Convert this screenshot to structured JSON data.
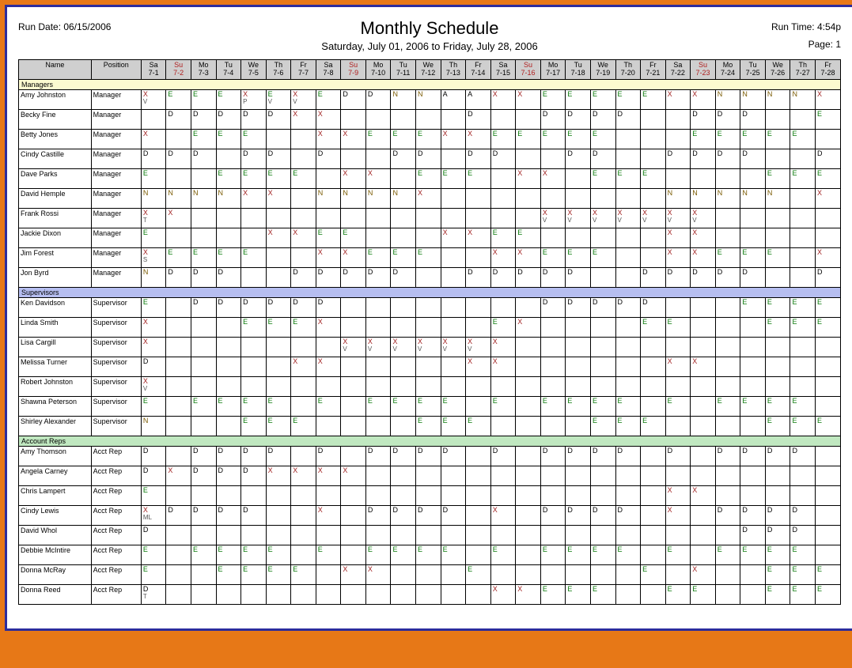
{
  "header": {
    "run_date": "Run Date: 06/15/2006",
    "run_time": "Run Time: 4:54p",
    "title": "Monthly Schedule",
    "range": "Saturday, July 01, 2006 to Friday, July 28, 2006",
    "page": "Page: 1",
    "name_col": "Name",
    "pos_col": "Position"
  },
  "days": [
    {
      "dow": "Sa",
      "md": "7-1"
    },
    {
      "dow": "Su",
      "md": "7-2",
      "sun": true
    },
    {
      "dow": "Mo",
      "md": "7-3"
    },
    {
      "dow": "Tu",
      "md": "7-4"
    },
    {
      "dow": "We",
      "md": "7-5"
    },
    {
      "dow": "Th",
      "md": "7-6"
    },
    {
      "dow": "Fr",
      "md": "7-7"
    },
    {
      "dow": "Sa",
      "md": "7-8"
    },
    {
      "dow": "Su",
      "md": "7-9",
      "sun": true
    },
    {
      "dow": "Mo",
      "md": "7-10"
    },
    {
      "dow": "Tu",
      "md": "7-11"
    },
    {
      "dow": "We",
      "md": "7-12"
    },
    {
      "dow": "Th",
      "md": "7-13"
    },
    {
      "dow": "Fr",
      "md": "7-14"
    },
    {
      "dow": "Sa",
      "md": "7-15"
    },
    {
      "dow": "Su",
      "md": "7-16",
      "sun": true
    },
    {
      "dow": "Mo",
      "md": "7-17"
    },
    {
      "dow": "Tu",
      "md": "7-18"
    },
    {
      "dow": "We",
      "md": "7-19"
    },
    {
      "dow": "Th",
      "md": "7-20"
    },
    {
      "dow": "Fr",
      "md": "7-21"
    },
    {
      "dow": "Sa",
      "md": "7-22"
    },
    {
      "dow": "Su",
      "md": "7-23",
      "sun": true
    },
    {
      "dow": "Mo",
      "md": "7-24"
    },
    {
      "dow": "Tu",
      "md": "7-25"
    },
    {
      "dow": "We",
      "md": "7-26"
    },
    {
      "dow": "Th",
      "md": "7-27"
    },
    {
      "dow": "Fr",
      "md": "7-28"
    }
  ],
  "sections": [
    {
      "label": "Managers",
      "cls": "managers",
      "rows": [
        {
          "name": "Amy Johnston",
          "pos": "Manager",
          "cells": [
            "X/V",
            "E",
            "E",
            "E",
            "X/P",
            "E/V",
            "X/V",
            "E",
            "D",
            "D",
            "N",
            "N",
            "A",
            "A",
            "X",
            "X",
            "E",
            "E",
            "E",
            "E",
            "E",
            "X",
            "X",
            "N",
            "N",
            "N",
            "N",
            "X"
          ]
        },
        {
          "name": "Becky Fine",
          "pos": "Manager",
          "cells": [
            "",
            "D",
            "D",
            "D",
            "D",
            "D",
            "X",
            "X",
            "",
            "",
            "",
            "",
            "",
            "D",
            "",
            "",
            "D",
            "D",
            "D",
            "D",
            "",
            "",
            "D",
            "D",
            "D",
            "",
            "",
            "E"
          ]
        },
        {
          "name": "Betty Jones",
          "pos": "Manager",
          "cells": [
            "X",
            "",
            "E",
            "E",
            "E",
            "",
            "",
            "X",
            "X",
            "E",
            "E",
            "E",
            "X",
            "X",
            "E",
            "E",
            "E",
            "E",
            "E",
            "",
            "",
            "",
            "E",
            "E",
            "E",
            "E",
            "E",
            ""
          ]
        },
        {
          "name": "Cindy Castille",
          "pos": "Manager",
          "cells": [
            "D",
            "D",
            "D",
            "",
            "D",
            "D",
            "",
            "D",
            "",
            "",
            "D",
            "D",
            "",
            "D",
            "D",
            "",
            "",
            "D",
            "D",
            "",
            "",
            "D",
            "D",
            "D",
            "D",
            "",
            "",
            "D"
          ]
        },
        {
          "name": "Dave Parks",
          "pos": "Manager",
          "cells": [
            "E",
            "",
            "",
            "E",
            "E",
            "E",
            "E",
            "",
            "X",
            "X",
            "",
            "E",
            "E",
            "E",
            "",
            "X",
            "X",
            "",
            "E",
            "E",
            "E",
            "",
            "",
            "",
            "",
            "E",
            "E",
            "E"
          ]
        },
        {
          "name": "David Hemple",
          "pos": "Manager",
          "cells": [
            "N",
            "N",
            "N",
            "N",
            "X",
            "X",
            "",
            "N",
            "N",
            "N",
            "N",
            "X",
            "",
            "",
            "",
            "",
            "",
            "",
            "",
            "",
            "",
            "N",
            "N",
            "N",
            "N",
            "N",
            "",
            "X"
          ]
        },
        {
          "name": "Frank Rossi",
          "pos": "Manager",
          "cells": [
            "X/T",
            "X",
            "",
            "",
            "",
            "",
            "",
            "",
            "",
            "",
            "",
            "",
            "",
            "",
            "",
            "",
            "X/V",
            "X/V",
            "X/V",
            "X/V",
            "X/V",
            "X/V",
            "X/V",
            "",
            "",
            "",
            "",
            ""
          ]
        },
        {
          "name": "Jackie Dixon",
          "pos": "Manager",
          "cells": [
            "E",
            "",
            "",
            "",
            "",
            "X",
            "X",
            "E",
            "E",
            "",
            "",
            "",
            "X",
            "X",
            "E",
            "E",
            "",
            "",
            "",
            "",
            "",
            "X",
            "X",
            "",
            "",
            "",
            "",
            ""
          ]
        },
        {
          "name": "Jim Forest",
          "pos": "Manager",
          "cells": [
            "X/S",
            "E",
            "E",
            "E",
            "E",
            "",
            "",
            "X",
            "X",
            "E",
            "E",
            "E",
            "",
            "",
            "X",
            "X",
            "E",
            "E",
            "E",
            "",
            "",
            "X",
            "X",
            "E",
            "E",
            "E",
            "",
            "X"
          ]
        },
        {
          "name": "Jon Byrd",
          "pos": "Manager",
          "cells": [
            "N",
            "D",
            "D",
            "D",
            "",
            "",
            "D",
            "D",
            "D",
            "D",
            "D",
            "",
            "",
            "D",
            "D",
            "D",
            "D",
            "D",
            "",
            "",
            "D",
            "D",
            "D",
            "D",
            "D",
            "",
            "",
            "D"
          ]
        }
      ]
    },
    {
      "label": "Supervisors",
      "cls": "supervisors",
      "rows": [
        {
          "name": "Ken Davidson",
          "pos": "Supervisor",
          "cells": [
            "E",
            "",
            "D",
            "D",
            "D",
            "D",
            "D",
            "D",
            "",
            "",
            "",
            "",
            "",
            "",
            "",
            "",
            "D",
            "D",
            "D",
            "D",
            "D",
            "",
            "",
            "",
            "E",
            "E",
            "E",
            "E"
          ]
        },
        {
          "name": "Linda Smith",
          "pos": "Supervisor",
          "cells": [
            "X",
            "",
            "",
            "",
            "E",
            "E",
            "E",
            "X",
            "",
            "",
            "",
            "",
            "",
            "",
            "E",
            "X",
            "",
            "",
            "",
            "",
            "E",
            "E",
            "",
            "",
            "",
            "E",
            "E",
            "E"
          ]
        },
        {
          "name": "Lisa Cargill",
          "pos": "Supervisor",
          "cells": [
            "X",
            "",
            "",
            "",
            "",
            "",
            "",
            "",
            "X/V",
            "X/V",
            "X/V",
            "X/V",
            "X/V",
            "X/V",
            "X",
            "",
            "",
            "",
            "",
            "",
            "",
            "",
            "",
            "",
            "",
            "",
            "",
            ""
          ]
        },
        {
          "name": "Melissa Turner",
          "pos": "Supervisor",
          "cells": [
            "D",
            "",
            "",
            "",
            "",
            "",
            "X",
            "X",
            "",
            "",
            "",
            "",
            "",
            "X",
            "X",
            "",
            "",
            "",
            "",
            "",
            "",
            "X",
            "X",
            "",
            "",
            "",
            "",
            ""
          ]
        },
        {
          "name": "Robert Johnston",
          "pos": "Supervisor",
          "cells": [
            "X/V",
            "",
            "",
            "",
            "",
            "",
            "",
            "",
            "",
            "",
            "",
            "",
            "",
            "",
            "",
            "",
            "",
            "",
            "",
            "",
            "",
            "",
            "",
            "",
            "",
            "",
            "",
            ""
          ]
        },
        {
          "name": "Shawna Peterson",
          "pos": "Supervisor",
          "cells": [
            "E",
            "",
            "E",
            "E",
            "E",
            "E",
            "",
            "E",
            "",
            "E",
            "E",
            "E",
            "E",
            "",
            "E",
            "",
            "E",
            "E",
            "E",
            "E",
            "",
            "E",
            "",
            "E",
            "E",
            "E",
            "E",
            ""
          ]
        },
        {
          "name": "Shirley Alexander",
          "pos": "Supervisor",
          "cells": [
            "N",
            "",
            "",
            "",
            "E",
            "E",
            "E",
            "",
            "",
            "",
            "",
            "E",
            "E",
            "E",
            "",
            "",
            "",
            "",
            "E",
            "E",
            "E",
            "",
            "",
            "",
            "",
            "E",
            "E",
            "E"
          ]
        }
      ]
    },
    {
      "label": "Account Reps",
      "cls": "accountreps",
      "rows": [
        {
          "name": "Amy Thomson",
          "pos": "Acct Rep",
          "cells": [
            "D",
            "",
            "D",
            "D",
            "D",
            "D",
            "",
            "D",
            "",
            "D",
            "D",
            "D",
            "D",
            "",
            "D",
            "",
            "D",
            "D",
            "D",
            "D",
            "",
            "D",
            "",
            "D",
            "D",
            "D",
            "D",
            ""
          ]
        },
        {
          "name": "Angela Carney",
          "pos": "Acct Rep",
          "cells": [
            "D",
            "X",
            "D",
            "D",
            "D",
            "X",
            "X",
            "X",
            "X",
            "",
            "",
            "",
            "",
            "",
            "",
            "",
            "",
            "",
            "",
            "",
            "",
            "",
            "",
            "",
            "",
            "",
            "",
            ""
          ]
        },
        {
          "name": "Chris Lampert",
          "pos": "Acct Rep",
          "cells": [
            "E",
            "",
            "",
            "",
            "",
            "",
            "",
            "",
            "",
            "",
            "",
            "",
            "",
            "",
            "",
            "",
            "",
            "",
            "",
            "",
            "",
            "X",
            "X",
            "",
            "",
            "",
            "",
            ""
          ]
        },
        {
          "name": "Cindy Lewis",
          "pos": "Acct Rep",
          "cells": [
            "X/ML",
            "D",
            "D",
            "D",
            "D",
            "",
            "",
            "X",
            "",
            "D",
            "D",
            "D",
            "D",
            "",
            "X",
            "",
            "D",
            "D",
            "D",
            "D",
            "",
            "X",
            "",
            "D",
            "D",
            "D",
            "D",
            ""
          ]
        },
        {
          "name": "David Whol",
          "pos": "Acct Rep",
          "cells": [
            "D",
            "",
            "",
            "",
            "",
            "",
            "",
            "",
            "",
            "",
            "",
            "",
            "",
            "",
            "",
            "",
            "",
            "",
            "",
            "",
            "",
            "",
            "",
            "",
            "D",
            "D",
            "D",
            ""
          ]
        },
        {
          "name": "Debbie McIntire",
          "pos": "Acct Rep",
          "cells": [
            "E",
            "",
            "E",
            "E",
            "E",
            "E",
            "",
            "E",
            "",
            "E",
            "E",
            "E",
            "E",
            "",
            "E",
            "",
            "E",
            "E",
            "E",
            "E",
            "",
            "E",
            "",
            "E",
            "E",
            "E",
            "E",
            ""
          ]
        },
        {
          "name": "Donna McRay",
          "pos": "Acct Rep",
          "cells": [
            "E",
            "",
            "",
            "E",
            "E",
            "E",
            "E",
            "",
            "X",
            "X",
            "",
            "",
            "",
            "E",
            "",
            "",
            "",
            "",
            "",
            "",
            "E",
            "",
            "X",
            "",
            "",
            "E",
            "E",
            "E"
          ]
        },
        {
          "name": "Donna Reed",
          "pos": "Acct Rep",
          "cells": [
            "D/T",
            "",
            "",
            "",
            "",
            "",
            "",
            "",
            "",
            "",
            "",
            "",
            "",
            "",
            "X",
            "X",
            "E",
            "E",
            "E",
            "",
            "",
            "E",
            "E",
            "",
            "",
            "E",
            "E",
            "E"
          ]
        }
      ]
    }
  ]
}
